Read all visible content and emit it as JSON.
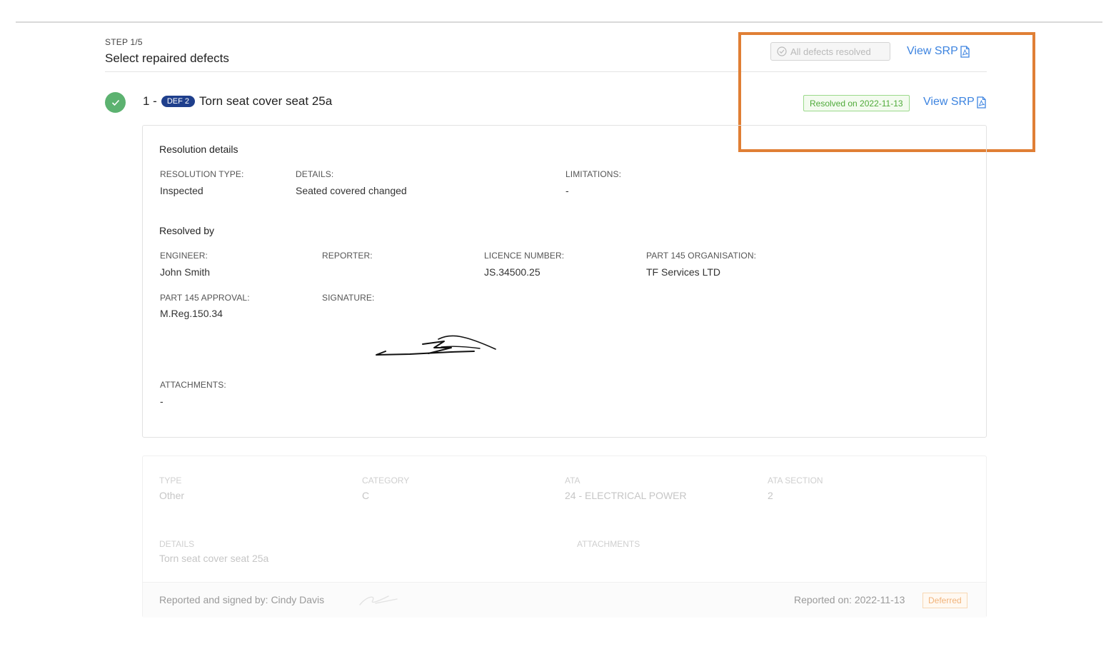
{
  "header": {
    "step": "STEP 1/5",
    "title": "Select repaired defects",
    "all_resolved_label": "All defects resolved",
    "view_srp_label": "View SRP"
  },
  "defect": {
    "number": "1 -",
    "badge": "DEF 2",
    "title": "Torn seat cover seat 25a",
    "resolved_badge": "Resolved on 2022-11-13",
    "view_srp_label": "View SRP"
  },
  "resolution": {
    "section_title": "Resolution details",
    "type_label": "RESOLUTION TYPE:",
    "type_value": "Inspected",
    "details_label": "DETAILS:",
    "details_value": "Seated covered changed",
    "limitations_label": "LIMITATIONS:",
    "limitations_value": "-"
  },
  "resolved_by": {
    "section_title": "Resolved by",
    "engineer_label": "ENGINEER:",
    "engineer_value": "John Smith",
    "reporter_label": "REPORTER:",
    "licence_label": "LICENCE NUMBER:",
    "licence_value": "JS.34500.25",
    "org_label": "PART 145 ORGANISATION:",
    "org_value": "TF Services LTD",
    "approval_label": "PART 145 APPROVAL:",
    "approval_value": "M.Reg.150.34",
    "signature_label": "SIGNATURE:",
    "attachments_label": "ATTACHMENTS:",
    "attachments_value": "-"
  },
  "defect_info": {
    "type_label": "TYPE",
    "type_value": "Other",
    "category_label": "CATEGORY",
    "category_value": "C",
    "ata_label": "ATA",
    "ata_value": "24 - ELECTRICAL POWER",
    "ata_section_label": "ATA SECTION",
    "ata_section_value": "2",
    "details_label": "DETAILS",
    "details_value": "Torn seat cover seat 25a",
    "attachments_label": "ATTACHMENTS",
    "reported_by": "Reported and signed by: Cindy Davis",
    "reported_on": "Reported on: 2022-11-13",
    "deferred_badge": "Deferred"
  },
  "colors": {
    "accent_link": "#3d84e0",
    "highlight": "#e07f35",
    "success": "#5cb270",
    "badge_blue": "#1f3f8c"
  }
}
